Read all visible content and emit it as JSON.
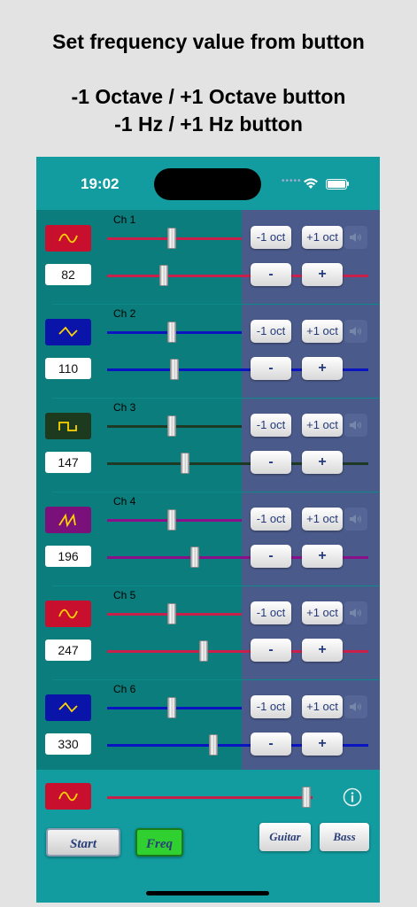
{
  "captions": {
    "line1": "Set frequency value from button",
    "line2": "-1 Octave / +1 Octave button",
    "line3": "-1 Hz / +1 Hz button"
  },
  "status": {
    "time": "19:02",
    "dots": "•••••"
  },
  "labels": {
    "minus_oct": "-1 oct",
    "plus_oct": "+1 oct",
    "minus": "-",
    "plus": "+"
  },
  "channels": [
    {
      "name": "Ch 1",
      "freq": "82",
      "wave": "sine",
      "color": "#c8102e",
      "track_color": "#c8204a",
      "volume": 0.48,
      "freq_slider": 0.42
    },
    {
      "name": "Ch 2",
      "freq": "110",
      "wave": "triangle",
      "color": "#0a14a8",
      "track_color": "#0a14c0",
      "volume": 0.48,
      "freq_slider": 0.5
    },
    {
      "name": "Ch 3",
      "freq": "147",
      "wave": "square",
      "color": "#1e3a1e",
      "track_color": "#1e3a24",
      "volume": 0.48,
      "freq_slider": 0.58
    },
    {
      "name": "Ch 4",
      "freq": "196",
      "wave": "sawtooth",
      "color": "#7a107a",
      "track_color": "#8a108a",
      "volume": 0.48,
      "freq_slider": 0.65
    },
    {
      "name": "Ch 5",
      "freq": "247",
      "wave": "sine",
      "color": "#c8102e",
      "track_color": "#c8204a",
      "volume": 0.48,
      "freq_slider": 0.72
    },
    {
      "name": "Ch 6",
      "freq": "330",
      "wave": "triangle",
      "color": "#0a14a8",
      "track_color": "#0a14c0",
      "volume": 0.48,
      "freq_slider": 0.79
    }
  ],
  "bottom": {
    "wave": "sine",
    "color": "#c8102e",
    "master_slider": 0.97,
    "info_icon": "info-icon",
    "start_label": "Start",
    "freq_label": "Freq",
    "guitar_label": "Guitar",
    "bass_label": "Bass",
    "freq_active_color": "#2fd02f"
  },
  "colors": {
    "background": "#e3e3e3",
    "phone_bg": "#0f9296",
    "left_panel": "#0b7d7d",
    "right_panel": "#4a5a8a"
  }
}
